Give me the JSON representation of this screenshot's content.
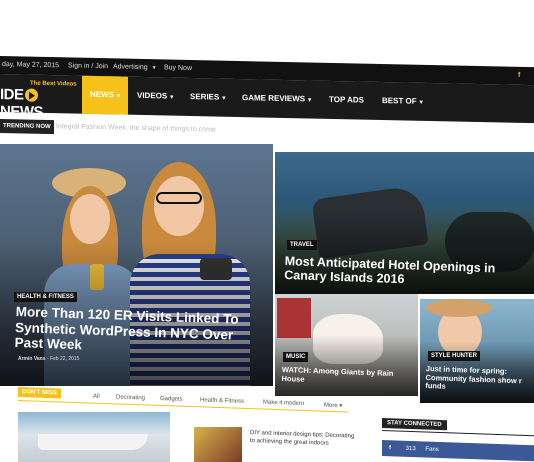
{
  "topbar": {
    "date": "day, May 27, 2015",
    "signin": "Sign in / Join",
    "advertising": "Advertising",
    "buy": "Buy Now",
    "social_icon": "facebook-icon"
  },
  "logo": {
    "tagline": "The Best Videos",
    "name": "VIDEO NEWS",
    "name_left": "IDE",
    "name_right": "NEWS"
  },
  "nav": {
    "items": [
      {
        "label": "NEWS",
        "dropdown": true
      },
      {
        "label": "VIDEOS",
        "dropdown": true
      },
      {
        "label": "SERIES",
        "dropdown": true
      },
      {
        "label": "GAME REVIEWS",
        "dropdown": true
      },
      {
        "label": "TOP ADS",
        "dropdown": false
      },
      {
        "label": "BEST OF",
        "dropdown": true
      }
    ],
    "accent": "#f6c21a"
  },
  "trending": {
    "label": "TRENDING NOW",
    "text": "Integral Fashion Week: the shape of things to come"
  },
  "hero": {
    "main": {
      "category": "HEALTH & FITNESS",
      "title": "More Than 120 ER Visits Linked To Synthetic WordPress In NYC Over Past Week",
      "author": "Armin Vans",
      "date": "Feb 22, 2015"
    },
    "hotel": {
      "category": "TRAVEL",
      "title": "Most Anticipated Hotel Openings in Canary Islands 2016"
    },
    "dog": {
      "category": "MUSIC",
      "title": "WATCH: Among Giants by Rain House"
    },
    "style": {
      "category": "STYLE HUNTER",
      "title": "Just in time for spring: Community fashion show r funds"
    }
  },
  "dont_miss": {
    "label": "DON'T MISS",
    "tabs": [
      "All",
      "Decorating",
      "Gadgets",
      "Health & Fitness",
      "Make it modern",
      "More"
    ]
  },
  "side_post": {
    "title": "DIY and interior design tips: Decorating to achieving the great indoors"
  },
  "stay_connected": {
    "label": "STAY CONNECTED",
    "fb_count": "313",
    "fb_label": "Fans"
  }
}
